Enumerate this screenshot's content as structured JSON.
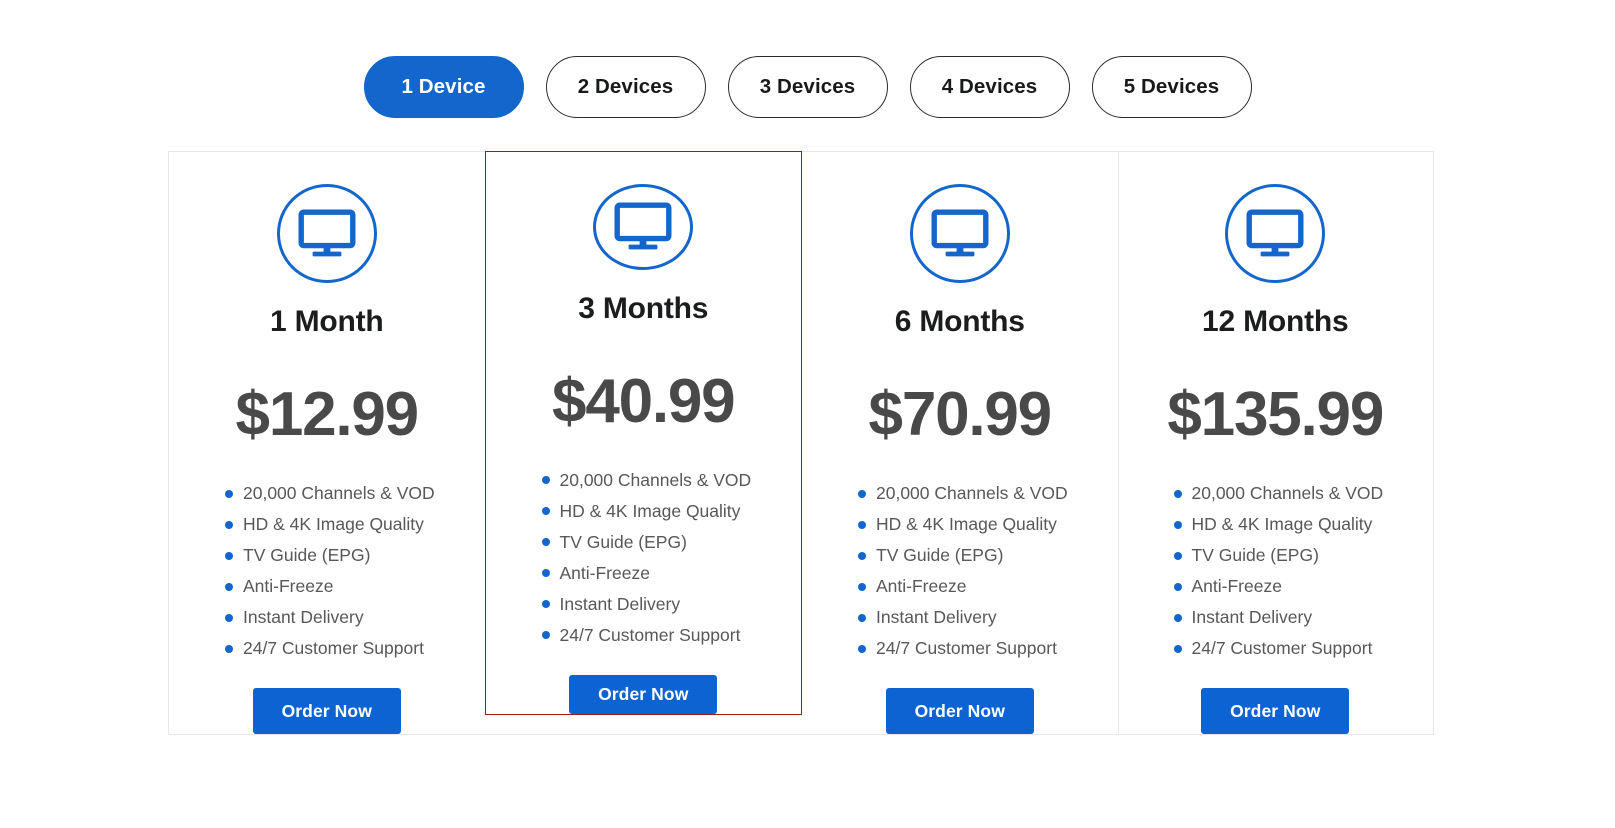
{
  "device_selector": {
    "name": "device-count-selector",
    "active_index": 0,
    "options": [
      {
        "label": "1 Device",
        "active": true
      },
      {
        "label": "2 Devices",
        "active": false
      },
      {
        "label": "3 Devices",
        "active": false
      },
      {
        "label": "4 Devices",
        "active": false
      },
      {
        "label": "5 Devices",
        "active": false
      }
    ]
  },
  "colors": {
    "accent_blue": "#1266cc",
    "button_blue": "#0d63d1",
    "featured_border": "#9e1b1b",
    "price_gray": "#494949",
    "feature_gray": "#58585c",
    "title_dark": "#1b1c1e",
    "divider": "#e8e8e8"
  },
  "plans": [
    {
      "icon": "tv-monitor-icon",
      "title": "1 Month",
      "price": "$12.99",
      "featured": false,
      "cta_label": "Order Now",
      "features": [
        "20,000 Channels & VOD",
        "HD & 4K Image Quality",
        "TV Guide (EPG)",
        "Anti-Freeze",
        "Instant Delivery",
        "24/7 Customer Support"
      ]
    },
    {
      "icon": "tv-monitor-icon",
      "title": "3 Months",
      "price": "$40.99",
      "featured": true,
      "cta_label": "Order Now",
      "features": [
        "20,000 Channels & VOD",
        "HD & 4K Image Quality",
        "TV Guide (EPG)",
        "Anti-Freeze",
        "Instant Delivery",
        "24/7 Customer Support"
      ]
    },
    {
      "icon": "tv-monitor-icon",
      "title": "6 Months",
      "price": "$70.99",
      "featured": false,
      "cta_label": "Order Now",
      "features": [
        "20,000 Channels & VOD",
        "HD & 4K Image Quality",
        "TV Guide (EPG)",
        "Anti-Freeze",
        "Instant Delivery",
        "24/7 Customer Support"
      ]
    },
    {
      "icon": "tv-monitor-icon",
      "title": "12 Months",
      "price": "$135.99",
      "featured": false,
      "cta_label": "Order Now",
      "features": [
        "20,000 Channels & VOD",
        "HD & 4K Image Quality",
        "TV Guide (EPG)",
        "Anti-Freeze",
        "Instant Delivery",
        "24/7 Customer Support"
      ]
    }
  ]
}
